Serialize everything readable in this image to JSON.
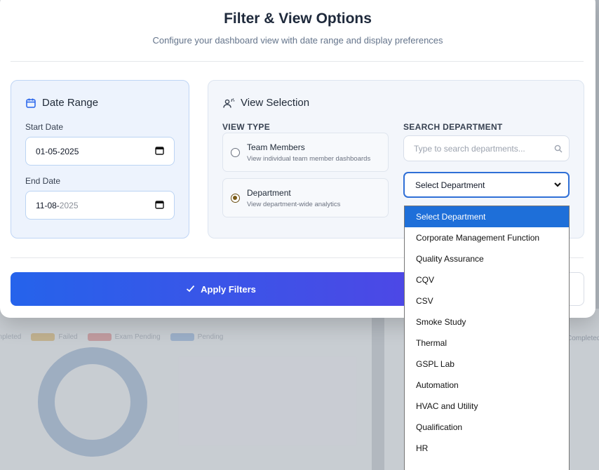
{
  "modal": {
    "title": "Filter & View Options",
    "subtitle": "Configure your dashboard view with date range and display preferences"
  },
  "date_range": {
    "heading": "Date Range",
    "start_label": "Start Date",
    "start_value_day_month": "01-05-",
    "start_value_year": "2025",
    "end_label": "End Date",
    "end_value_day_month": "11-08-",
    "end_value_year": "2025",
    "icon": "calendar-icon"
  },
  "view_selection": {
    "heading": "View Selection",
    "icon": "users-settings-icon",
    "view_type_label": "VIEW TYPE",
    "options": [
      {
        "title": "Team Members",
        "description": "View individual team member dashboards",
        "checked": false
      },
      {
        "title": "Department",
        "description": "View department-wide analytics",
        "checked": true
      }
    ],
    "search_label": "SEARCH DEPARTMENT",
    "search_placeholder": "Type to search departments...",
    "select_value": "Select Department"
  },
  "actions": {
    "apply_label": "Apply Filters"
  },
  "department_dropdown": {
    "selected_index": 0,
    "options": [
      "Select Department",
      "Corporate Management Function",
      "Quality Assurance",
      "CQV",
      "CSV",
      "Smoke Study",
      "Thermal",
      "GSPL Lab",
      "Automation",
      "HVAC and Utility",
      "Qualification",
      "HR",
      ""
    ]
  },
  "background": {
    "legend": [
      {
        "label": "Completed",
        "color": "#9aa9bd"
      },
      {
        "label": "Failed",
        "color": "#d9b56a"
      },
      {
        "label": "Exam Pending",
        "color": "#d98a8a"
      },
      {
        "label": "Pending",
        "color": "#8fb0d9"
      }
    ],
    "right_text": "Completed"
  },
  "colors": {
    "accent": "#2563eb",
    "accent_end": "#4f46e5",
    "selected_option": "#1e6fd9",
    "radio_checked": "#7a5a14"
  }
}
